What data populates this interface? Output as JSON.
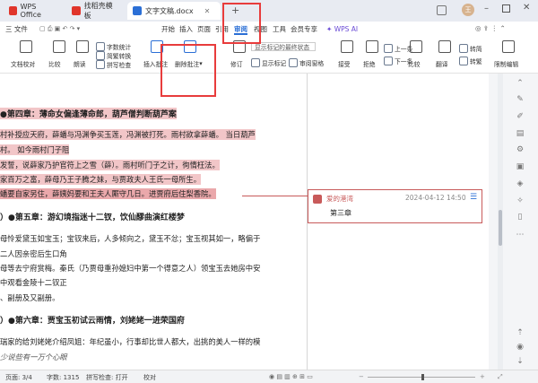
{
  "titlebar": {
    "tabs": [
      {
        "label": "WPS Office"
      },
      {
        "label": "找稻壳模板"
      },
      {
        "label": "文字文稿.docx"
      }
    ],
    "new_tab": "+",
    "avatar_text": "王"
  },
  "menubar": {
    "file_label": "三 文件",
    "items": [
      "开始",
      "插入",
      "页面",
      "引用",
      "审阅",
      "视图",
      "工具",
      "会员专享"
    ],
    "ai_label": "WPS AI"
  },
  "ribbon": {
    "doc_check": "文档校对",
    "compare": "比较",
    "read_aloud": "朗读",
    "word_count": "字数统计",
    "simp_trad": "简繁转换",
    "spell_check": "拼写检查",
    "insert_comment": "插入批注",
    "delete_comment": "删除批注",
    "revise": "修订",
    "display_mode": "显示标记的最终状态",
    "show_marks": "显示标记",
    "review_pane": "审阅窗格",
    "accept": "接受",
    "reject": "拒绝",
    "previous": "上一条",
    "next": "下一条",
    "compare2": "比较",
    "translate": "翻译",
    "convert_simple": "转简",
    "convert_trad": "转繁",
    "restrict_edit": "限制编辑"
  },
  "document": {
    "lines": [
      {
        "text": "●第四章：薄命女偏逢薄命郎，葫芦僧判断葫芦案",
        "kind": "heading-hl"
      },
      {
        "text": "村补授应天府，薛蟠与冯渊争买玉莲，冯渊被打死。雨村欲拿薛蟠。 当日葫芦",
        "kind": "hl"
      },
      {
        "text": "村。 如今雨村门子阻",
        "kind": "hl"
      },
      {
        "text": "发誓，说薛家乃护官符上之雪（薛）。雨村听门子之计，徇情枉法。",
        "kind": "hl"
      },
      {
        "text": "家百万之富，薛母乃王子腾之妹，与贾政夫人王氏一母所生。",
        "kind": "hl"
      },
      {
        "text": "蟠要自家另住，薛姨妈要和王夫人厮守几日。进贾府后住梨香院。",
        "kind": "hl-strong"
      },
      {
        "text": "）●第五章：游幻境指迷十二钗，饮仙醪曲演红楼梦",
        "kind": "heading"
      },
      {
        "text": "母怜爱黛玉如宝玉；宝钗来后，人多倾向之，黛玉不忿；宝玉视其如一，略偏于",
        "kind": "normal"
      },
      {
        "text": "二人因亲密后生口角",
        "kind": "normal"
      },
      {
        "text": "母等去宁府赏梅。秦氏（乃贾母重孙媳妇中第一个得意之人）领宝玉去她房中安",
        "kind": "normal"
      },
      {
        "text": "中观看金陵十二钗正",
        "kind": "normal"
      },
      {
        "text": "、副册及又副册。",
        "kind": "normal"
      },
      {
        "text": "）●第六章：贾宝玉初试云雨情，刘姥姥一进荣国府",
        "kind": "heading"
      },
      {
        "text": "瑞家的给刘姥姥介绍凤姐：年纪虽小，行事却比世人都大，出挑的美人一样的模",
        "kind": "normal"
      },
      {
        "text": "少说些有一万个心眼",
        "kind": "normal"
      }
    ]
  },
  "comment": {
    "author": "爱的港湾",
    "date": "2024-04-12 14:50",
    "text": "第三章"
  },
  "statusbar": {
    "page": "页面: 3/4",
    "words": "字数: 1315",
    "spell": "拼写检查: 打开",
    "proof": "校对"
  },
  "colors": {
    "highlight": "#f2c6c8",
    "comment_border": "#c85a5a",
    "annotation_red": "#e83c3c",
    "accent": "#2b6fd6"
  }
}
